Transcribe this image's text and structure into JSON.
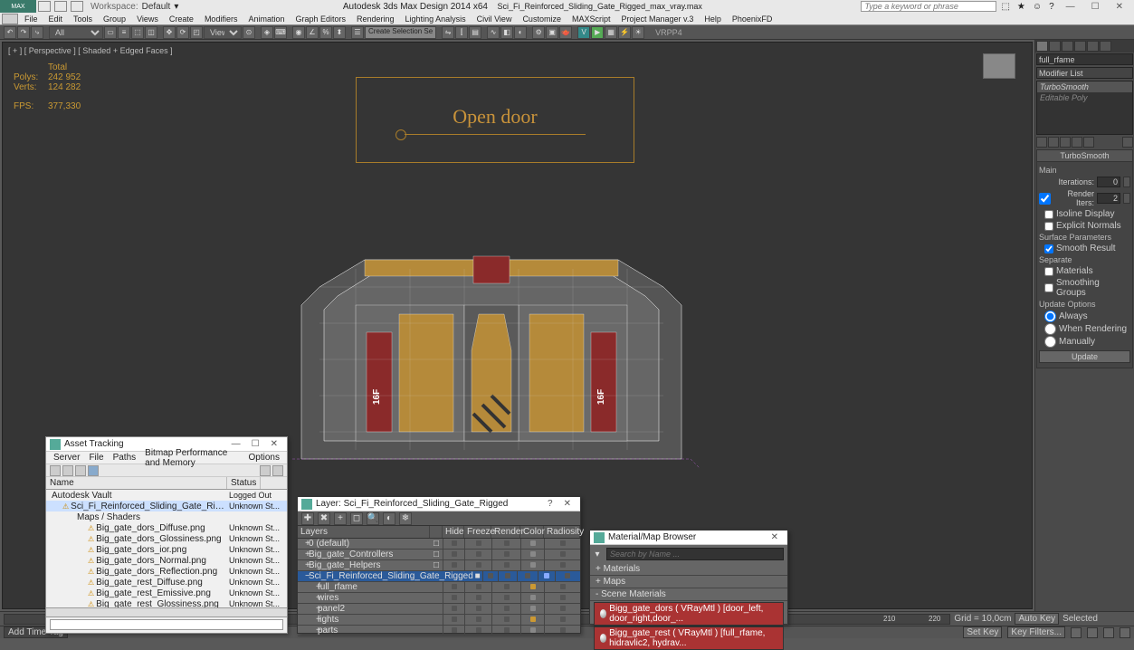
{
  "titlebar": {
    "workspace_label": "Workspace:",
    "workspace_value": "Default",
    "app_title": "Autodesk 3ds Max Design 2014 x64",
    "file_name": "Sci_Fi_Reinforced_Sliding_Gate_Rigged_max_vray.max",
    "search_placeholder": "Type a keyword or phrase"
  },
  "menu": [
    "File",
    "Edit",
    "Tools",
    "Group",
    "Views",
    "Create",
    "Modifiers",
    "Animation",
    "Graph Editors",
    "Rendering",
    "Lighting Analysis",
    "Civil View",
    "Customize",
    "MAXScript",
    "Project Manager v.3",
    "Help",
    "PhoenixFD"
  ],
  "toolbar": {
    "sel_filter": "All",
    "view_btn": "View",
    "create_set": "Create Selection Se",
    "vrpp": "VRPP4"
  },
  "viewport": {
    "label": "[ + ] [ Perspective ] [ Shaded + Edged Faces ]",
    "stats": {
      "total": "Total",
      "polys_l": "Polys:",
      "polys_v": "242 952",
      "verts_l": "Verts:",
      "verts_v": "124 282",
      "fps_l": "FPS:",
      "fps_v": "377,330"
    },
    "opendoor": "Open door"
  },
  "rpanel": {
    "name": "full_rfame",
    "modifier_list": "Modifier List",
    "stack": [
      "TurboSmooth",
      "Editable Poly"
    ],
    "roll_title": "TurboSmooth",
    "main": "Main",
    "iterations_l": "Iterations:",
    "iterations_v": "0",
    "render_iters_l": "Render Iters:",
    "render_iters_v": "2",
    "isoline": "Isoline Display",
    "explicit": "Explicit Normals",
    "surf": "Surface Parameters",
    "smooth": "Smooth Result",
    "separate": "Separate",
    "materials": "Materials",
    "smoothing": "Smoothing Groups",
    "update": "Update Options",
    "always": "Always",
    "when_render": "When Rendering",
    "manually": "Manually",
    "update_btn": "Update"
  },
  "timeline": {
    "frame_a": "210",
    "frame_b": "220",
    "grid": "Grid = 10,0cm",
    "add_tag": "Add Time Tag",
    "autokey": "Auto Key",
    "setkey": "Set Key",
    "selected": "Selected",
    "keyfilters": "Key Filters..."
  },
  "assetwin": {
    "title": "Asset Tracking",
    "menu": [
      "Server",
      "File",
      "Paths",
      "Bitmap Performance and Memory",
      "Options"
    ],
    "col_name": "Name",
    "col_status": "Status",
    "rows": [
      {
        "lvl": 0,
        "nm": "Autodesk Vault",
        "st": "Logged Out"
      },
      {
        "lvl": 1,
        "nm": "Sci_Fi_Reinforced_Sliding_Gate_Rigged_max_vra...",
        "st": "Unknown St..."
      },
      {
        "lvl": 2,
        "nm": "Maps / Shaders",
        "st": ""
      },
      {
        "lvl": 3,
        "nm": "Big_gate_dors_Diffuse.png",
        "st": "Unknown St..."
      },
      {
        "lvl": 3,
        "nm": "Big_gate_dors_Glossiness.png",
        "st": "Unknown St..."
      },
      {
        "lvl": 3,
        "nm": "Big_gate_dors_ior.png",
        "st": "Unknown St..."
      },
      {
        "lvl": 3,
        "nm": "Big_gate_dors_Normal.png",
        "st": "Unknown St..."
      },
      {
        "lvl": 3,
        "nm": "Big_gate_dors_Reflection.png",
        "st": "Unknown St..."
      },
      {
        "lvl": 3,
        "nm": "Big_gate_rest_Diffuse.png",
        "st": "Unknown St..."
      },
      {
        "lvl": 3,
        "nm": "Big_gate_rest_Emissive.png",
        "st": "Unknown St..."
      },
      {
        "lvl": 3,
        "nm": "Big_gate_rest_Glossiness.png",
        "st": "Unknown St..."
      }
    ]
  },
  "layerwin": {
    "title": "Layer: Sci_Fi_Reinforced_Sliding_Gate_Rigged",
    "cols": [
      "Layers",
      "",
      "Hide",
      "Freeze",
      "Render",
      "Color",
      "Radiosity"
    ],
    "rows": [
      {
        "lvl": 0,
        "exp": "+",
        "nm": "0 (default)",
        "cb": "□"
      },
      {
        "lvl": 0,
        "exp": "+",
        "nm": "Big_gate_Controllers",
        "cb": "□"
      },
      {
        "lvl": 0,
        "exp": "+",
        "nm": "Big_gate_Helpers",
        "cb": "□"
      },
      {
        "lvl": 0,
        "exp": "−",
        "nm": "Sci_Fi_Reinforced_Sliding_Gate_Rigged",
        "cb": "■",
        "sel": true
      },
      {
        "lvl": 1,
        "exp": "+",
        "nm": "full_rfame",
        "cb": ""
      },
      {
        "lvl": 1,
        "exp": "+",
        "nm": "wires",
        "cb": ""
      },
      {
        "lvl": 1,
        "exp": "+",
        "nm": "panel2",
        "cb": ""
      },
      {
        "lvl": 1,
        "exp": "+",
        "nm": "lights",
        "cb": ""
      },
      {
        "lvl": 1,
        "exp": "+",
        "nm": "parts",
        "cb": ""
      }
    ]
  },
  "matwin": {
    "title": "Material/Map Browser",
    "search": "Search by Name ...",
    "nodes": [
      "+ Materials",
      "+ Maps",
      "- Scene Materials"
    ],
    "mats": [
      "Bigg_gate_dors ( VRayMtl ) [door_left, door_right,door_...",
      "Bigg_gate_rest ( VRayMtl ) [full_rfame, hidravlic2, hydrav..."
    ]
  }
}
